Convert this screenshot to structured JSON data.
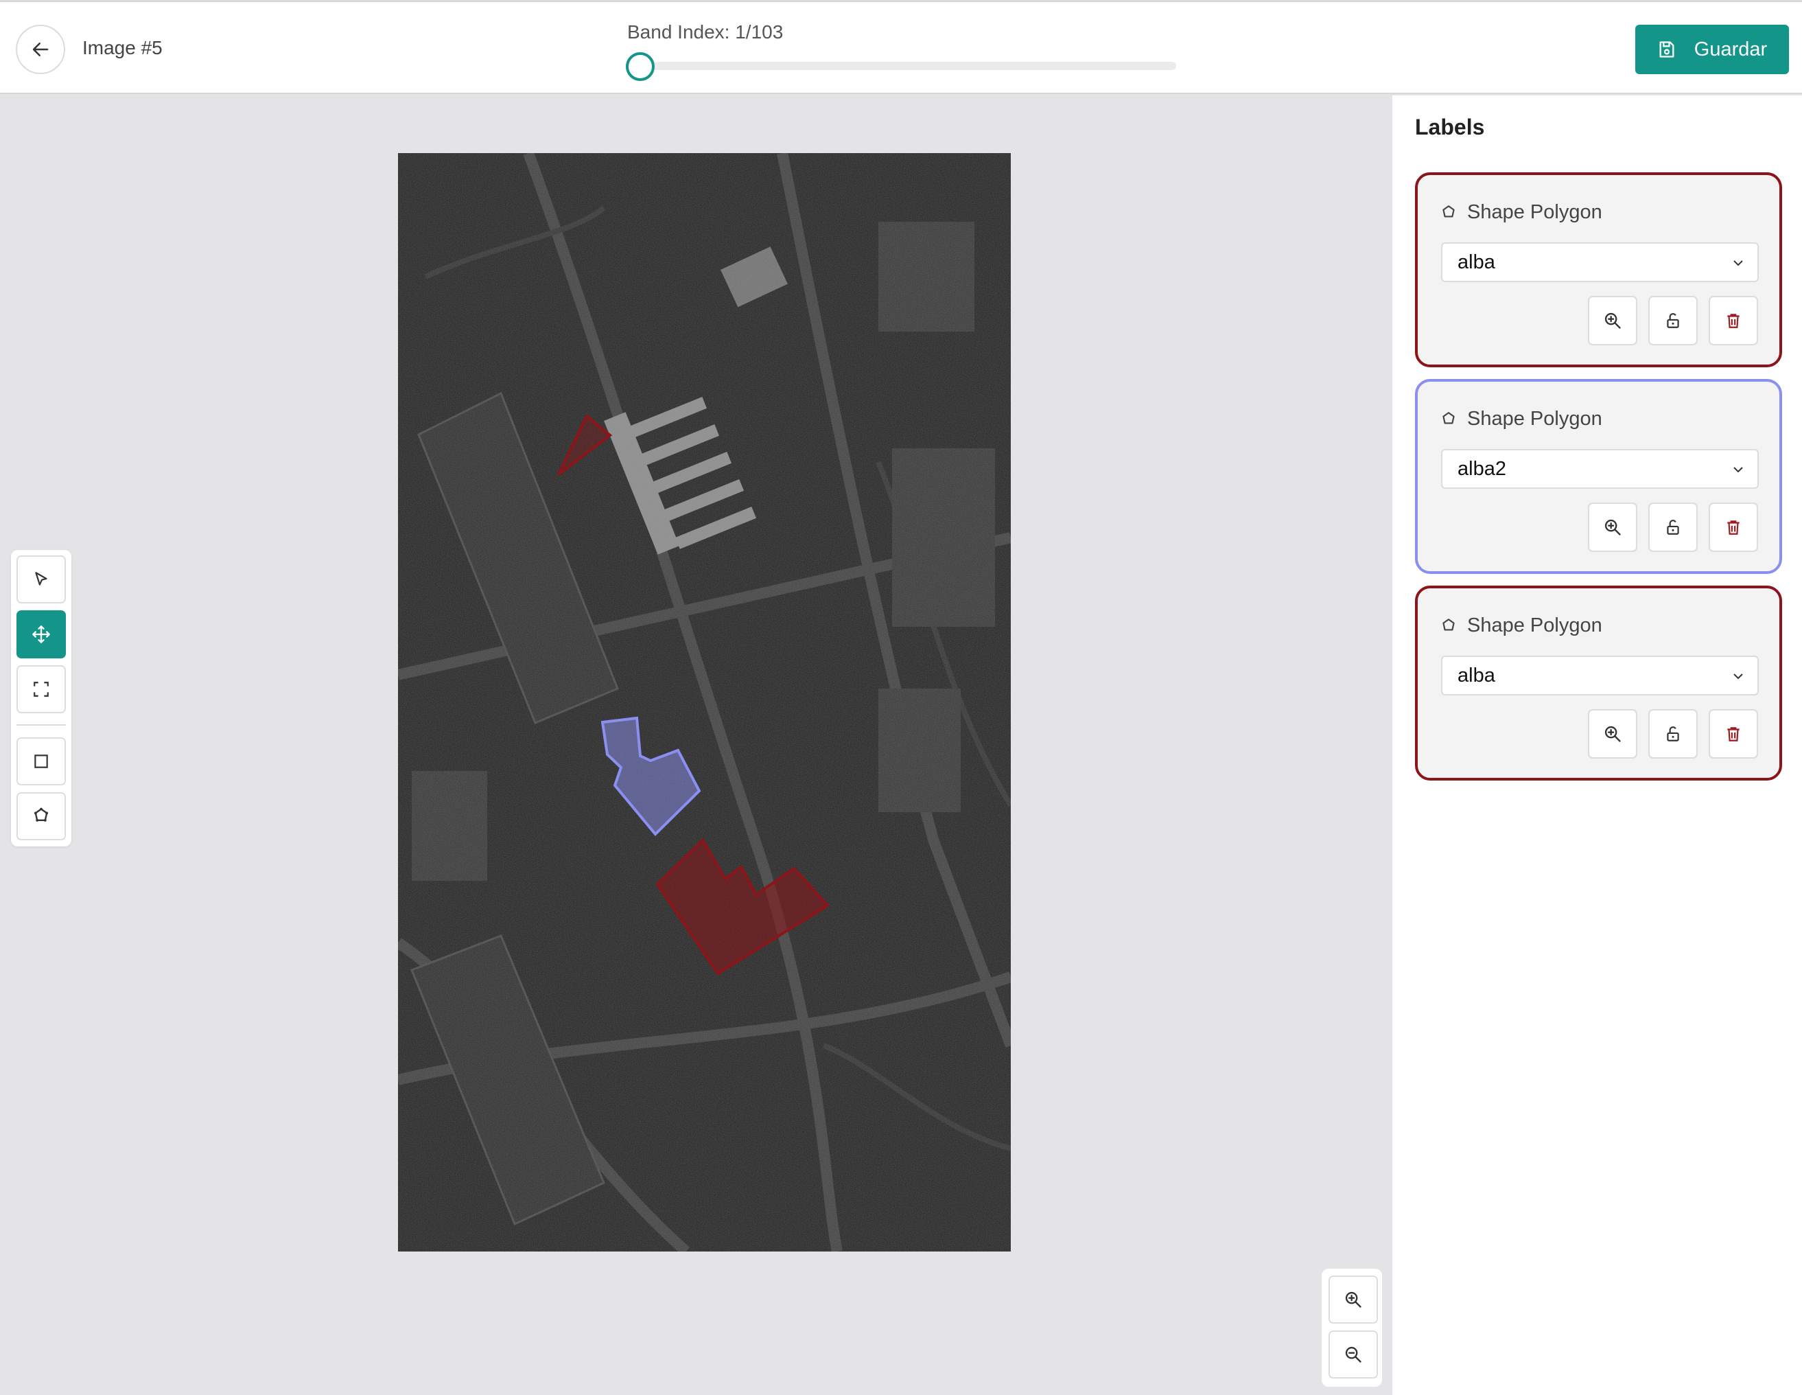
{
  "header": {
    "title": "Image #5",
    "band_label": "Band Index: 1/103",
    "band_index": 1,
    "band_total": 103,
    "save_label": "Guardar"
  },
  "colors": {
    "accent": "#13958a",
    "label_red": "#8b1518",
    "label_blue": "#8b8ff0"
  },
  "toolbar": {
    "tools": [
      "pointer-icon",
      "move-icon",
      "fit-screen-icon",
      "rectangle-icon",
      "polygon-icon"
    ],
    "active_tool": "move-icon"
  },
  "zoom": {
    "tools": [
      "zoom-in-icon",
      "zoom-out-icon"
    ]
  },
  "labels_panel": {
    "title": "Labels",
    "cards": [
      {
        "kind": "Shape Polygon",
        "value": "alba",
        "color": "#8b1518"
      },
      {
        "kind": "Shape Polygon",
        "value": "alba2",
        "color": "#8b8ff0"
      },
      {
        "kind": "Shape Polygon",
        "value": "alba",
        "color": "#8b1518"
      }
    ]
  }
}
